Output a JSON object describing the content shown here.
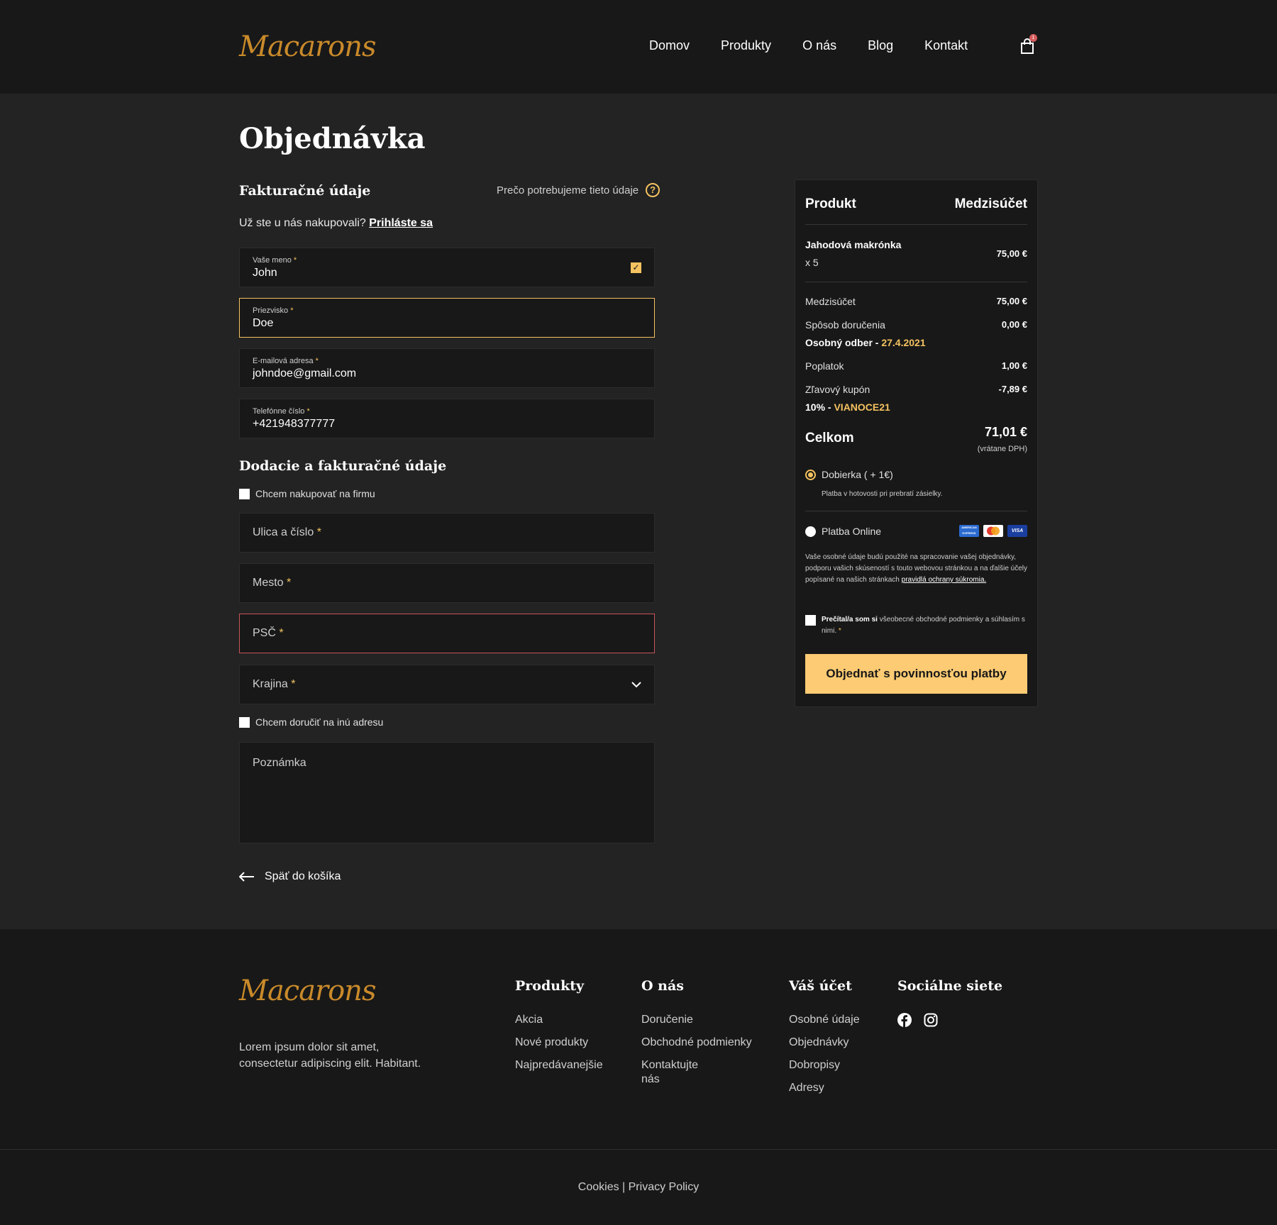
{
  "brand": "Macarons",
  "nav": [
    "Domov",
    "Produkty",
    "O nás",
    "Blog",
    "Kontakt"
  ],
  "cart": {
    "count": "1"
  },
  "page_title": "Objednávka",
  "billing": {
    "heading": "Fakturačné údaje",
    "why": "Prečo potrebujeme tieto údaje",
    "login_prompt": "Už ste u nás nakupovali?",
    "login_link": "Prihláste sa",
    "first_name": {
      "label": "Vaše meno",
      "value": "John"
    },
    "last_name": {
      "label": "Priezvisko",
      "value": "Doe"
    },
    "email": {
      "label": "E-mailová adresa",
      "value": "johndoe@gmail.com"
    },
    "phone": {
      "label": "Telefónne číslo",
      "value": "+421948377777"
    }
  },
  "delivery": {
    "heading": "Dodacie a fakturačné údaje",
    "company_checkbox": "Chcem nakupovať na firmu",
    "street": "Ulica a číslo",
    "city": "Mesto",
    "zip": "PSČ",
    "country": "Krajina",
    "other_address": "Chcem doručiť na inú adresu",
    "note": "Poznámka"
  },
  "back_link": "Späť do košíka",
  "summary": {
    "col_product": "Produkt",
    "col_subtotal": "Medzisúčet",
    "item_name": "Jahodová makrónka",
    "item_qty": "x 5",
    "item_price": "75,00 €",
    "subtotal_label": "Medzisúčet",
    "subtotal_value": "75,00 €",
    "shipping_label": "Spôsob doručenia",
    "shipping_value": "0,00 €",
    "shipping_method": "Osobný odber - ",
    "shipping_date": "27.4.2021",
    "fee_label": "Poplatok",
    "fee_value": "1,00 €",
    "coupon_label": "Zľavový kupón",
    "coupon_value": "-7,89 €",
    "coupon_percent": "10% - ",
    "coupon_code": "VIANOCE21",
    "total_label": "Celkom",
    "total_value": "71,01 €",
    "total_vat": "(vrátane DPH)",
    "pay_cod": "Dobierka ( + 1€)",
    "pay_cod_desc": "Platba v hotovosti pri prebratí zásielky.",
    "pay_online": "Platba Online",
    "privacy_text": "Vaše osobné údaje budú použité na spracovanie vašej objednávky, podporu vašich skúseností s touto webovou stránkou a na ďalšie účely popísané na našich stránkach",
    "privacy_link": "pravidlá ochrany súkromia.",
    "terms_prefix": "Prečítal/a som si",
    "terms_text": "všeobecné obchodné podmienky a súhlasím s nimi.",
    "order_button": "Objednať s povinnosťou platby",
    "card_amex": "AMERICAN EXPRESS",
    "card_visa": "VISA"
  },
  "footer": {
    "desc": "Lorem ipsum dolor sit amet, consectetur adipiscing elit. Habitant.",
    "col1": {
      "title": "Produkty",
      "links": [
        "Akcia",
        "Nové produkty",
        "Najpredávanejšie"
      ]
    },
    "col2": {
      "title": "O nás",
      "links": [
        "Doručenie",
        "Obchodné podmienky",
        "Kontaktujte nás"
      ]
    },
    "col3": {
      "title": "Váš účet",
      "links": [
        "Osobné údaje",
        "Objednávky",
        "Dobropisy",
        "Adresy"
      ]
    },
    "col4": {
      "title": "Sociálne siete"
    },
    "legal": "Cookies | Privacy Policy"
  },
  "colors": {
    "accent": "#f4c260",
    "button": "#fccb73",
    "error": "#c8555a",
    "logo": "#c98a2a"
  }
}
